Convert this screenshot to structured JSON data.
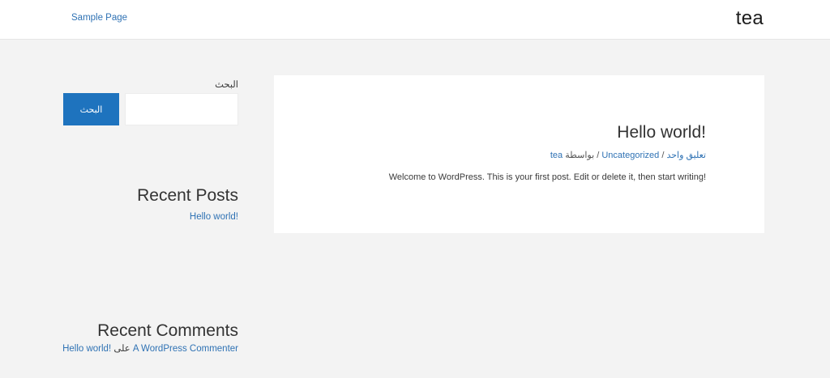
{
  "header": {
    "nav_link": "Sample Page",
    "site_title": "tea"
  },
  "sidebar": {
    "search_label": "البحث",
    "search_button": "البحث",
    "search_value": "",
    "recent_posts_title": "Recent Posts",
    "recent_posts": [
      "!Hello world"
    ],
    "recent_comments_title": "Recent Comments",
    "recent_comment": {
      "author": "A WordPress Commenter",
      "on": "على",
      "post": "!Hello world"
    }
  },
  "post": {
    "title": "!Hello world",
    "meta": {
      "comments": "تعليق واحد",
      "sep1": "/",
      "category": "Uncategorized",
      "sep2": "/",
      "by": "بواسطة",
      "author": "tea"
    },
    "excerpt": "!Welcome to WordPress. This is your first post. Edit or delete it, then start writing"
  }
}
